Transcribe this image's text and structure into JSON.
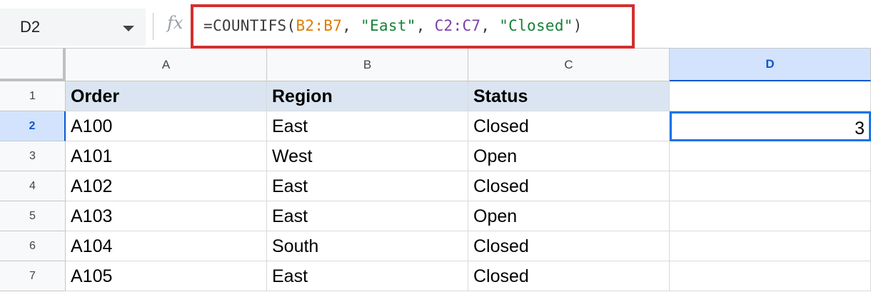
{
  "name_box": {
    "value": "D2"
  },
  "formula_bar": {
    "fx_label": "fx",
    "tokens": [
      {
        "text": "=COUNTIFS(",
        "color": "default"
      },
      {
        "text": "B2:B7",
        "color": "orange"
      },
      {
        "text": ", ",
        "color": "default"
      },
      {
        "text": "\"East\"",
        "color": "green"
      },
      {
        "text": ", ",
        "color": "default"
      },
      {
        "text": "C2:C7",
        "color": "purple"
      },
      {
        "text": ", ",
        "color": "default"
      },
      {
        "text": "\"Closed\"",
        "color": "green"
      },
      {
        "text": ")",
        "color": "default"
      }
    ],
    "highlight_color": "#d32f2f"
  },
  "columns": [
    "A",
    "B",
    "C",
    "D"
  ],
  "selected_column": "D",
  "rows": [
    "1",
    "2",
    "3",
    "4",
    "5",
    "6",
    "7"
  ],
  "selected_row": "2",
  "cells": [
    [
      "Order",
      "Region",
      "Status",
      ""
    ],
    [
      "A100",
      "East",
      "Closed",
      "3"
    ],
    [
      "A101",
      "West",
      "Open",
      ""
    ],
    [
      "A102",
      "East",
      "Closed",
      ""
    ],
    [
      "A103",
      "East",
      "Open",
      ""
    ],
    [
      "A104",
      "South",
      "Closed",
      ""
    ],
    [
      "A105",
      "East",
      "Closed",
      ""
    ]
  ],
  "active_cell": "D2",
  "colors": {
    "header_fill": "#dbe5f1",
    "selection": "#1a73e8",
    "selected_header": "#d3e3fd"
  }
}
